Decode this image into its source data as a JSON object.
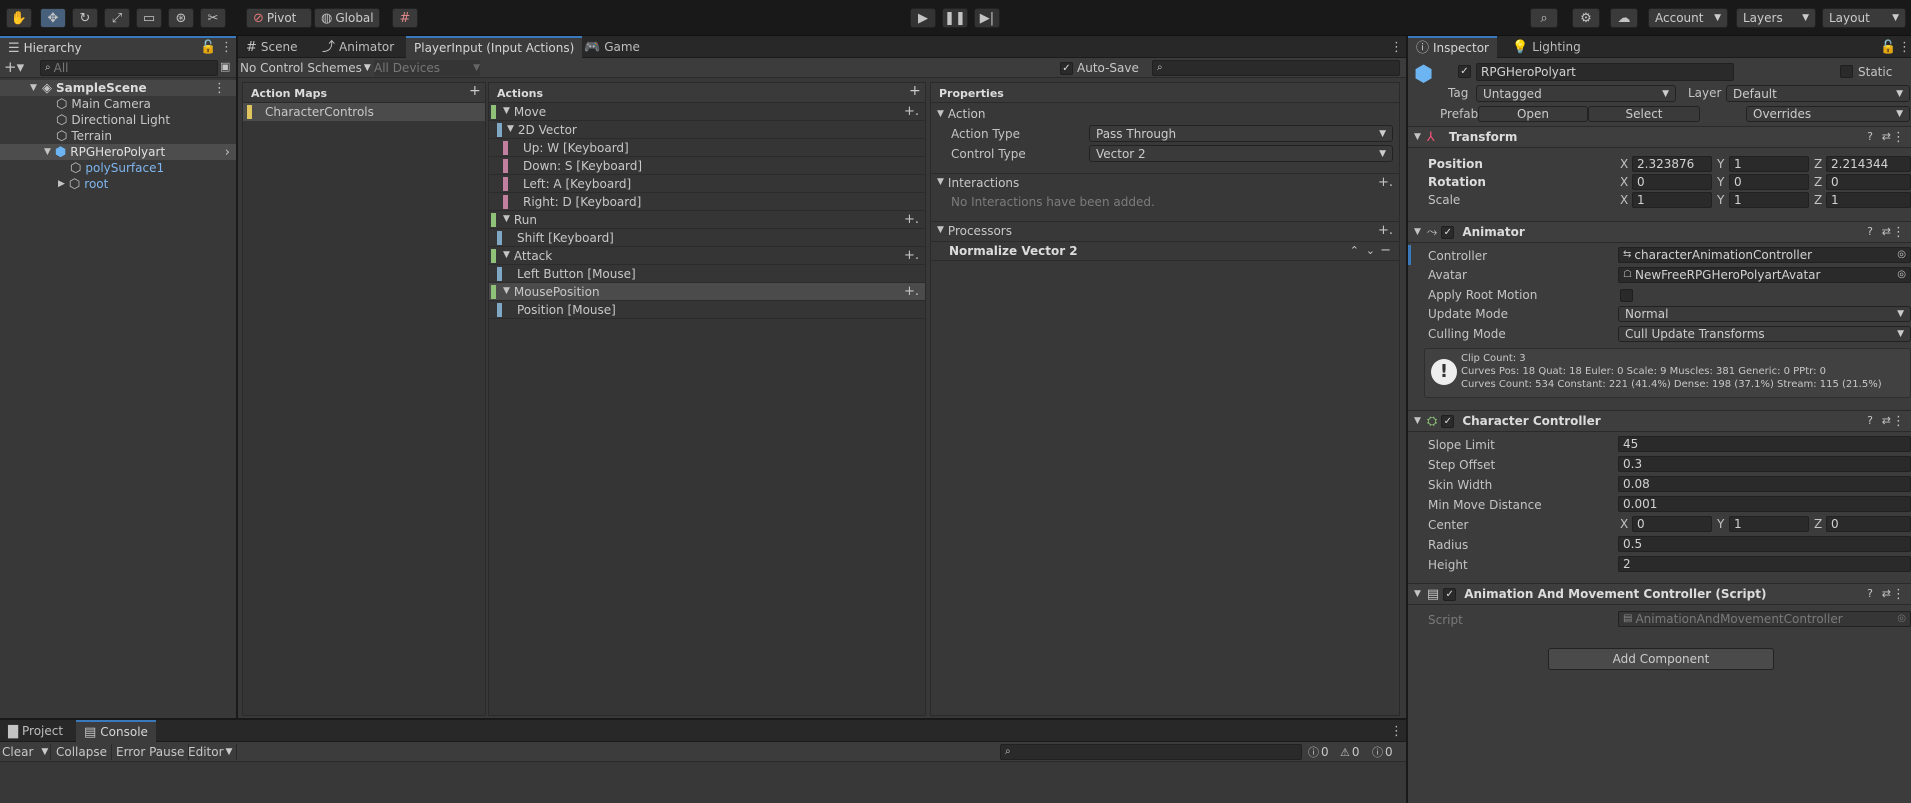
{
  "toolbar": {
    "tools": [
      "hand-tool-icon",
      "move-tool-icon",
      "rotate-tool-icon",
      "scale-tool-icon",
      "rect-tool-icon",
      "transform-tool-icon",
      "custom-tool-icon"
    ],
    "pivot_label": "Pivot",
    "global_label": "Global",
    "account_label": "Account",
    "layers_label": "Layers",
    "layout_label": "Layout"
  },
  "hierarchy": {
    "tab_label": "Hierarchy",
    "search_placeholder": "All",
    "items": [
      {
        "label": "SampleScene",
        "icon": "scene-icon"
      },
      {
        "label": "Main Camera",
        "icon": "gameobject-icon"
      },
      {
        "label": "Directional Light",
        "icon": "gameobject-icon"
      },
      {
        "label": "Terrain",
        "icon": "gameobject-icon"
      },
      {
        "label": "RPGHeroPolyart",
        "icon": "prefab-icon"
      },
      {
        "label": "polySurface1",
        "icon": "prefab-icon"
      },
      {
        "label": "root",
        "icon": "prefab-icon"
      }
    ]
  },
  "center": {
    "tabs": [
      "Scene",
      "Animator",
      "PlayerInput (Input Actions)",
      "Game"
    ],
    "control_schemes_label": "No Control Schemes",
    "devices_label": "All Devices",
    "autosave_label": "Auto-Save",
    "action_maps_header": "Action Maps",
    "action_maps": [
      "CharacterControls"
    ],
    "actions_header": "Actions",
    "actions": [
      {
        "label": "Move",
        "type": "action"
      },
      {
        "label": "2D Vector",
        "type": "composite"
      },
      {
        "label": "Up: W [Keyboard]",
        "type": "part"
      },
      {
        "label": "Down: S [Keyboard]",
        "type": "part"
      },
      {
        "label": "Left: A [Keyboard]",
        "type": "part"
      },
      {
        "label": "Right: D [Keyboard]",
        "type": "part"
      },
      {
        "label": "Run",
        "type": "action"
      },
      {
        "label": "Shift [Keyboard]",
        "type": "binding"
      },
      {
        "label": "Attack",
        "type": "action"
      },
      {
        "label": "Left Button [Mouse]",
        "type": "binding"
      },
      {
        "label": "MousePosition",
        "type": "action"
      },
      {
        "label": "Position [Mouse]",
        "type": "binding"
      }
    ],
    "properties_header": "Properties",
    "action_section": "Action",
    "action_type_label": "Action Type",
    "action_type_value": "Pass Through",
    "control_type_label": "Control Type",
    "control_type_value": "Vector 2",
    "interactions_section": "Interactions",
    "interactions_empty": "No Interactions have been added.",
    "processors_section": "Processors",
    "processor_item": "Normalize Vector 2"
  },
  "inspector": {
    "tabs": [
      "Inspector",
      "Lighting"
    ],
    "object_name": "RPGHeroPolyart",
    "static_label": "Static",
    "tag_label": "Tag",
    "tag_value": "Untagged",
    "layer_label": "Layer",
    "layer_value": "Default",
    "prefab_label": "Prefab",
    "prefab_open": "Open",
    "prefab_select": "Select",
    "prefab_overrides": "Overrides",
    "transform": {
      "title": "Transform",
      "position_label": "Position",
      "rotation_label": "Rotation",
      "scale_label": "Scale",
      "position": [
        "2.323876",
        "1",
        "2.214344"
      ],
      "rotation": [
        "0",
        "0",
        "0"
      ],
      "scale": [
        "1",
        "1",
        "1"
      ]
    },
    "animator": {
      "title": "Animator",
      "controller_label": "Controller",
      "controller_value": "characterAnimationController",
      "avatar_label": "Avatar",
      "avatar_value": "NewFreeRPGHeroPolyartAvatar",
      "apply_root_motion_label": "Apply Root Motion",
      "update_mode_label": "Update Mode",
      "update_mode_value": "Normal",
      "culling_mode_label": "Culling Mode",
      "culling_mode_value": "Cull Update Transforms",
      "info_line1": "Clip Count: 3",
      "info_line2": "Curves Pos: 18 Quat: 18 Euler: 0 Scale: 9 Muscles: 381 Generic: 0 PPtr: 0",
      "info_line3": "Curves Count: 534 Constant: 221 (41.4%) Dense: 198 (37.1%) Stream: 115 (21.5%)"
    },
    "character_controller": {
      "title": "Character Controller",
      "slope_limit_label": "Slope Limit",
      "slope_limit": "45",
      "step_offset_label": "Step Offset",
      "step_offset": "0.3",
      "skin_width_label": "Skin Width",
      "skin_width": "0.08",
      "min_move_label": "Min Move Distance",
      "min_move": "0.001",
      "center_label": "Center",
      "center": [
        "0",
        "1",
        "0"
      ],
      "radius_label": "Radius",
      "radius": "0.5",
      "height_label": "Height",
      "height": "2"
    },
    "script_component": {
      "title": "Animation And Movement Controller (Script)",
      "script_label": "Script",
      "script_value": "AnimationAndMovementController"
    },
    "add_component_label": "Add Component"
  },
  "bottom": {
    "tabs": [
      "Project",
      "Console"
    ],
    "clear_label": "Clear",
    "collapse_label": "Collapse",
    "error_pause_label": "Error Pause",
    "editor_label": "Editor",
    "log_count": "0",
    "warn_count": "0",
    "error_count": "0"
  },
  "axis_labels": {
    "x": "X",
    "y": "Y",
    "z": "Z"
  }
}
